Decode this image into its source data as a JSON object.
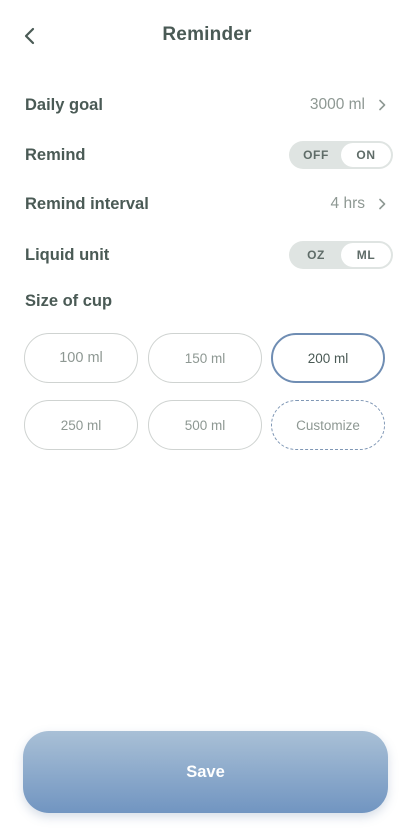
{
  "header": {
    "title": "Reminder",
    "back_icon": "chevron-left-icon"
  },
  "settings": {
    "daily_goal": {
      "label": "Daily goal",
      "value": "3000 ml"
    },
    "remind": {
      "label": "Remind",
      "off_label": "OFF",
      "on_label": "ON",
      "selected": "ON"
    },
    "remind_interval": {
      "label": "Remind interval",
      "value": "4 hrs"
    },
    "liquid_unit": {
      "label": "Liquid unit",
      "oz_label": "OZ",
      "ml_label": "ML",
      "selected": "ML"
    }
  },
  "cups": {
    "label": "Size of cup",
    "options": [
      "100 ml",
      "150 ml",
      "200 ml",
      "250 ml",
      "500 ml",
      "Customize"
    ],
    "selected": "200 ml"
  },
  "footer": {
    "save_label": "Save"
  },
  "colors": {
    "accent": "#6f8db3",
    "text": "#4a5a55",
    "muted": "#8e9893",
    "toggle_bg": "#dfe4e2"
  }
}
